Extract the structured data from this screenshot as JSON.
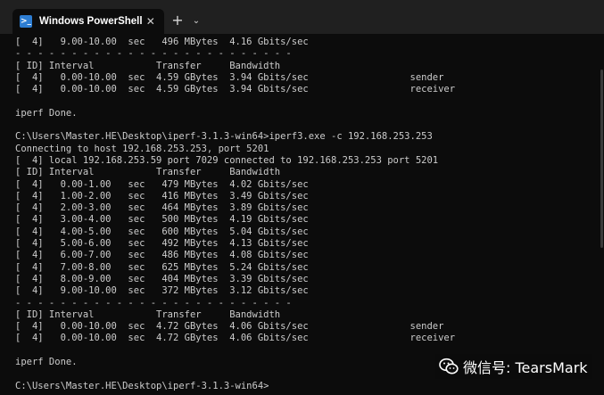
{
  "window": {
    "tab_title": "Windows PowerShell",
    "tab_icon": "powershell-icon",
    "close_glyph": "✕",
    "new_tab_glyph": "+",
    "dropdown_glyph": "⌄"
  },
  "terminal": {
    "lines": [
      "[  4]   9.00-10.00  sec   496 MBytes  4.16 Gbits/sec",
      "- - - - - - - - - - - - - - - - - - - - - - - - -",
      "[ ID] Interval           Transfer     Bandwidth",
      "[  4]   0.00-10.00  sec  4.59 GBytes  3.94 Gbits/sec                  sender",
      "[  4]   0.00-10.00  sec  4.59 GBytes  3.94 Gbits/sec                  receiver",
      "",
      "iperf Done.",
      "",
      "C:\\Users\\Master.HE\\Desktop\\iperf-3.1.3-win64>iperf3.exe -c 192.168.253.253",
      "Connecting to host 192.168.253.253, port 5201",
      "[  4] local 192.168.253.59 port 7029 connected to 192.168.253.253 port 5201",
      "[ ID] Interval           Transfer     Bandwidth",
      "[  4]   0.00-1.00   sec   479 MBytes  4.02 Gbits/sec",
      "[  4]   1.00-2.00   sec   416 MBytes  3.49 Gbits/sec",
      "[  4]   2.00-3.00   sec   464 MBytes  3.89 Gbits/sec",
      "[  4]   3.00-4.00   sec   500 MBytes  4.19 Gbits/sec",
      "[  4]   4.00-5.00   sec   600 MBytes  5.04 Gbits/sec",
      "[  4]   5.00-6.00   sec   492 MBytes  4.13 Gbits/sec",
      "[  4]   6.00-7.00   sec   486 MBytes  4.08 Gbits/sec",
      "[  4]   7.00-8.00   sec   625 MBytes  5.24 Gbits/sec",
      "[  4]   8.00-9.00   sec   404 MBytes  3.39 Gbits/sec",
      "[  4]   9.00-10.00  sec   372 MBytes  3.12 Gbits/sec",
      "- - - - - - - - - - - - - - - - - - - - - - - - -",
      "[ ID] Interval           Transfer     Bandwidth",
      "[  4]   0.00-10.00  sec  4.72 GBytes  4.06 Gbits/sec                  sender",
      "[  4]   0.00-10.00  sec  4.72 GBytes  4.06 Gbits/sec                  receiver",
      "",
      "iperf Done.",
      "",
      "C:\\Users\\Master.HE\\Desktop\\iperf-3.1.3-win64>"
    ]
  },
  "watermark": {
    "text": "微信号: TearsMark",
    "icon": "wechat-icon"
  }
}
